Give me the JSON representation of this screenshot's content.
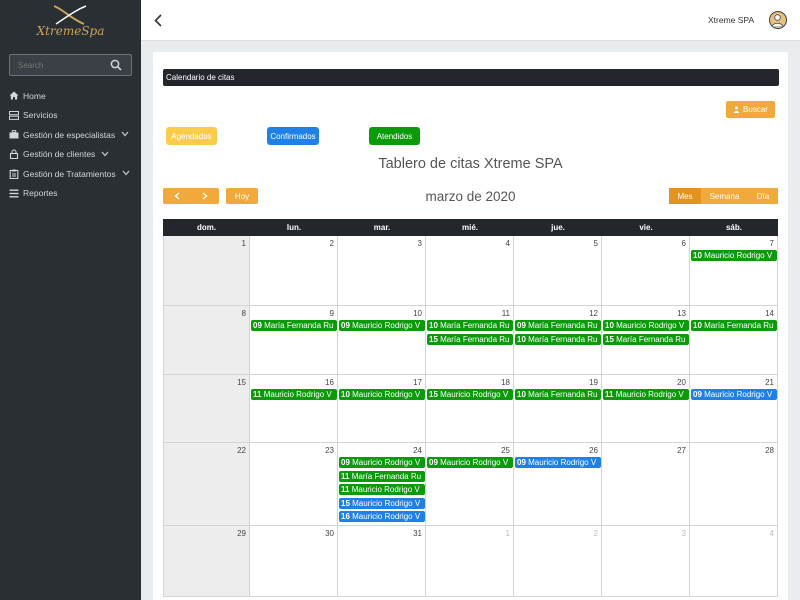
{
  "brand": {
    "logo_text": "XtremeSpa"
  },
  "search": {
    "placeholder": "Search"
  },
  "nav": [
    {
      "label": "Home",
      "icon": "home-icon",
      "chev": false
    },
    {
      "label": "Servicios",
      "icon": "list-icon",
      "chev": false
    },
    {
      "label": "Gestión de especialistas",
      "icon": "briefcase-icon",
      "chev": true
    },
    {
      "label": "Gestión de clientes",
      "icon": "lock-icon",
      "chev": true
    },
    {
      "label": "Gestión de Tratamientos",
      "icon": "clipboard-icon",
      "chev": true
    },
    {
      "label": "Reportes",
      "icon": "menu-icon",
      "chev": false
    }
  ],
  "topbar": {
    "user": "Xtreme SPA"
  },
  "card": {
    "header": "Calendario de citas",
    "search_button": "Buscar",
    "title": "Tablero de citas Xtreme SPA"
  },
  "legend": [
    {
      "label": "Agendados",
      "color": "#fbcb4a"
    },
    {
      "label": "Confirmados",
      "color": "#1f80e6"
    },
    {
      "label": "Atendidos",
      "color": "#0a9a0a"
    }
  ],
  "toolbar": {
    "today": "Hoy",
    "month_title": "marzo de 2020",
    "views": [
      "Mes",
      "Semana",
      "Día"
    ],
    "active_view": "Mes"
  },
  "calendar": {
    "weekdays": [
      "dom.",
      "lun.",
      "mar.",
      "mié.",
      "jue.",
      "vie.",
      "sáb."
    ],
    "colors": {
      "green": "#0a9a0a",
      "blue": "#1f80e6"
    },
    "weeks": [
      [
        {
          "n": "1",
          "other": false,
          "events": []
        },
        {
          "n": "2",
          "other": false,
          "events": []
        },
        {
          "n": "3",
          "other": false,
          "events": []
        },
        {
          "n": "4",
          "other": false,
          "events": []
        },
        {
          "n": "5",
          "other": false,
          "events": []
        },
        {
          "n": "6",
          "other": false,
          "events": []
        },
        {
          "n": "7",
          "other": false,
          "events": [
            {
              "time": "10",
              "name": "Mauricio Rodrigo V",
              "c": "green"
            }
          ]
        }
      ],
      [
        {
          "n": "8",
          "other": false,
          "events": []
        },
        {
          "n": "9",
          "other": false,
          "events": [
            {
              "time": "09",
              "name": "María Fernanda Ru",
              "c": "green"
            }
          ]
        },
        {
          "n": "10",
          "other": false,
          "events": [
            {
              "time": "09",
              "name": "Mauricio Rodrigo V",
              "c": "green"
            }
          ]
        },
        {
          "n": "11",
          "other": false,
          "events": [
            {
              "time": "10",
              "name": "María Fernanda Ru",
              "c": "green"
            },
            {
              "time": "15",
              "name": "María Fernanda Ru",
              "c": "green"
            }
          ]
        },
        {
          "n": "12",
          "other": false,
          "events": [
            {
              "time": "09",
              "name": "María Fernanda Ru",
              "c": "green"
            },
            {
              "time": "10",
              "name": "María Fernanda Ru",
              "c": "green"
            }
          ]
        },
        {
          "n": "13",
          "other": false,
          "events": [
            {
              "time": "10",
              "name": "Mauricio Rodrigo V",
              "c": "green"
            },
            {
              "time": "15",
              "name": "María Fernanda Ru",
              "c": "green"
            }
          ]
        },
        {
          "n": "14",
          "other": false,
          "events": [
            {
              "time": "10",
              "name": "María Fernanda Ru",
              "c": "green"
            }
          ]
        }
      ],
      [
        {
          "n": "15",
          "other": false,
          "events": []
        },
        {
          "n": "16",
          "other": false,
          "events": [
            {
              "time": "11",
              "name": "Mauricio Rodrigo V",
              "c": "green"
            }
          ]
        },
        {
          "n": "17",
          "other": false,
          "events": [
            {
              "time": "10",
              "name": "Mauricio Rodrigo V",
              "c": "green"
            }
          ]
        },
        {
          "n": "18",
          "other": false,
          "events": [
            {
              "time": "15",
              "name": "Mauricio Rodrigo V",
              "c": "green"
            }
          ]
        },
        {
          "n": "19",
          "other": false,
          "events": [
            {
              "time": "10",
              "name": "María Fernanda Ru",
              "c": "green"
            }
          ]
        },
        {
          "n": "20",
          "other": false,
          "events": [
            {
              "time": "11",
              "name": "Mauricio Rodrigo V",
              "c": "green"
            }
          ]
        },
        {
          "n": "21",
          "other": false,
          "events": [
            {
              "time": "09",
              "name": "Mauricio Rodrigo V",
              "c": "blue"
            }
          ]
        }
      ],
      [
        {
          "n": "22",
          "other": false,
          "events": []
        },
        {
          "n": "23",
          "other": false,
          "events": []
        },
        {
          "n": "24",
          "other": false,
          "events": [
            {
              "time": "09",
              "name": "Mauricio Rodrigo V",
              "c": "green"
            },
            {
              "time": "11",
              "name": "María Fernanda Ru",
              "c": "green"
            },
            {
              "time": "11",
              "name": "Mauricio Rodrigo V",
              "c": "green"
            },
            {
              "time": "15",
              "name": "Mauricio Rodrigo V",
              "c": "blue"
            },
            {
              "time": "16",
              "name": "Mauricio Rodrigo V",
              "c": "blue"
            }
          ]
        },
        {
          "n": "25",
          "other": false,
          "events": [
            {
              "time": "09",
              "name": "Mauricio Rodrigo V",
              "c": "green"
            }
          ]
        },
        {
          "n": "26",
          "other": false,
          "events": [
            {
              "time": "09",
              "name": "Mauricio Rodrigo V",
              "c": "blue"
            }
          ]
        },
        {
          "n": "27",
          "other": false,
          "events": []
        },
        {
          "n": "28",
          "other": false,
          "events": []
        }
      ],
      [
        {
          "n": "29",
          "other": false,
          "events": []
        },
        {
          "n": "30",
          "other": false,
          "events": []
        },
        {
          "n": "31",
          "other": false,
          "events": []
        },
        {
          "n": "1",
          "other": true,
          "events": []
        },
        {
          "n": "2",
          "other": true,
          "events": []
        },
        {
          "n": "3",
          "other": true,
          "events": []
        },
        {
          "n": "4",
          "other": true,
          "events": []
        }
      ]
    ]
  }
}
